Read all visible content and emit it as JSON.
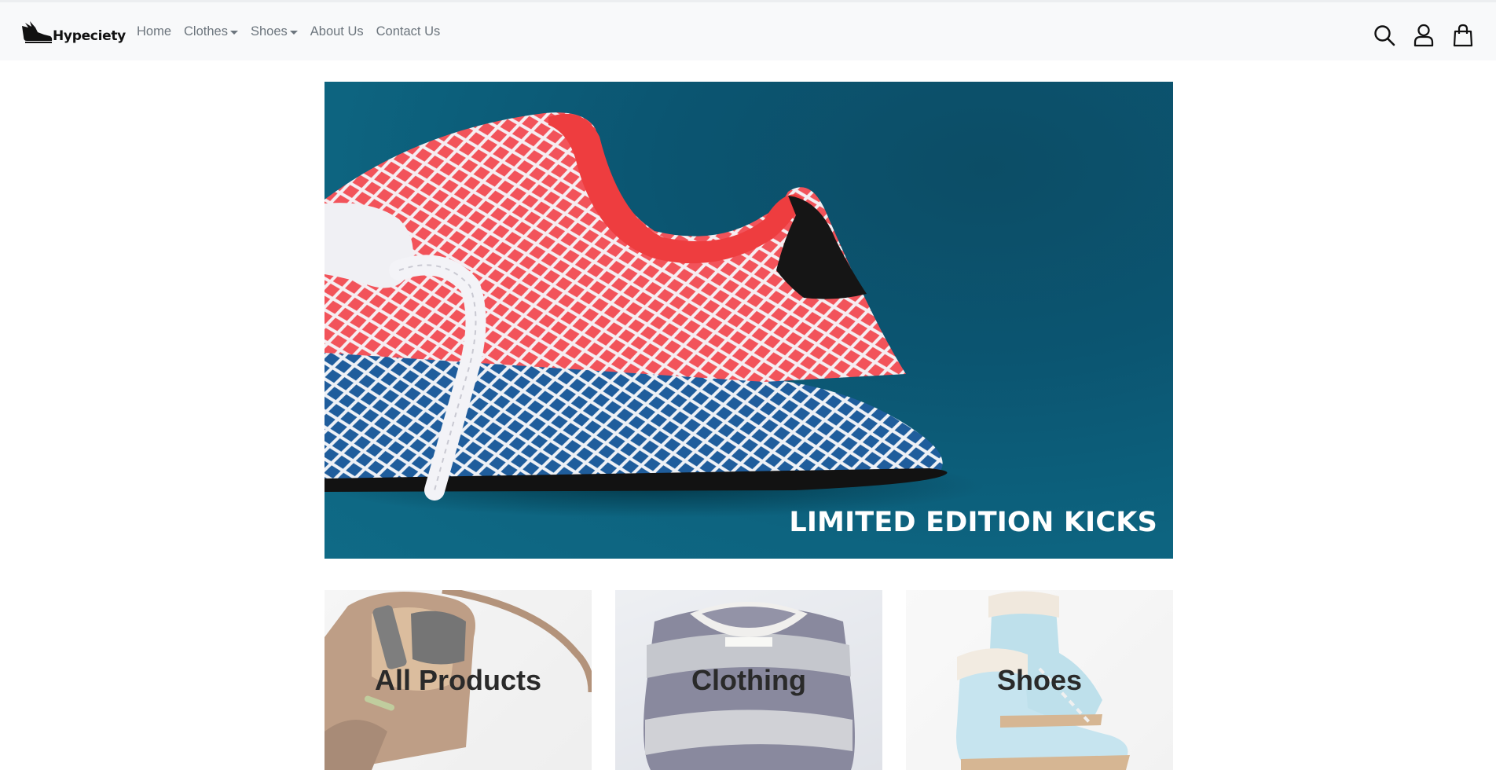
{
  "brand": {
    "name": "Hypeciety",
    "logo_icon": "winged-shoe-icon"
  },
  "nav": {
    "items": [
      {
        "label": "Home",
        "dropdown": false
      },
      {
        "label": "Clothes",
        "dropdown": true
      },
      {
        "label": "Shoes",
        "dropdown": true
      },
      {
        "label": "About Us",
        "dropdown": false
      },
      {
        "label": "Contact Us",
        "dropdown": false
      }
    ]
  },
  "header_icons": [
    "search-icon",
    "user-icon",
    "shopping-bag-icon"
  ],
  "hero": {
    "caption": "LIMITED EDITION KICKS"
  },
  "categories": [
    {
      "label": "All Products"
    },
    {
      "label": "Clothing"
    },
    {
      "label": "Shoes"
    }
  ],
  "colors": {
    "nav_bg": "#f8f9fa",
    "nav_text": "#6c757d",
    "hero_bg": "#0b5571",
    "shoe_red": "#f2535a",
    "shoe_blue": "#1f5d9c"
  }
}
